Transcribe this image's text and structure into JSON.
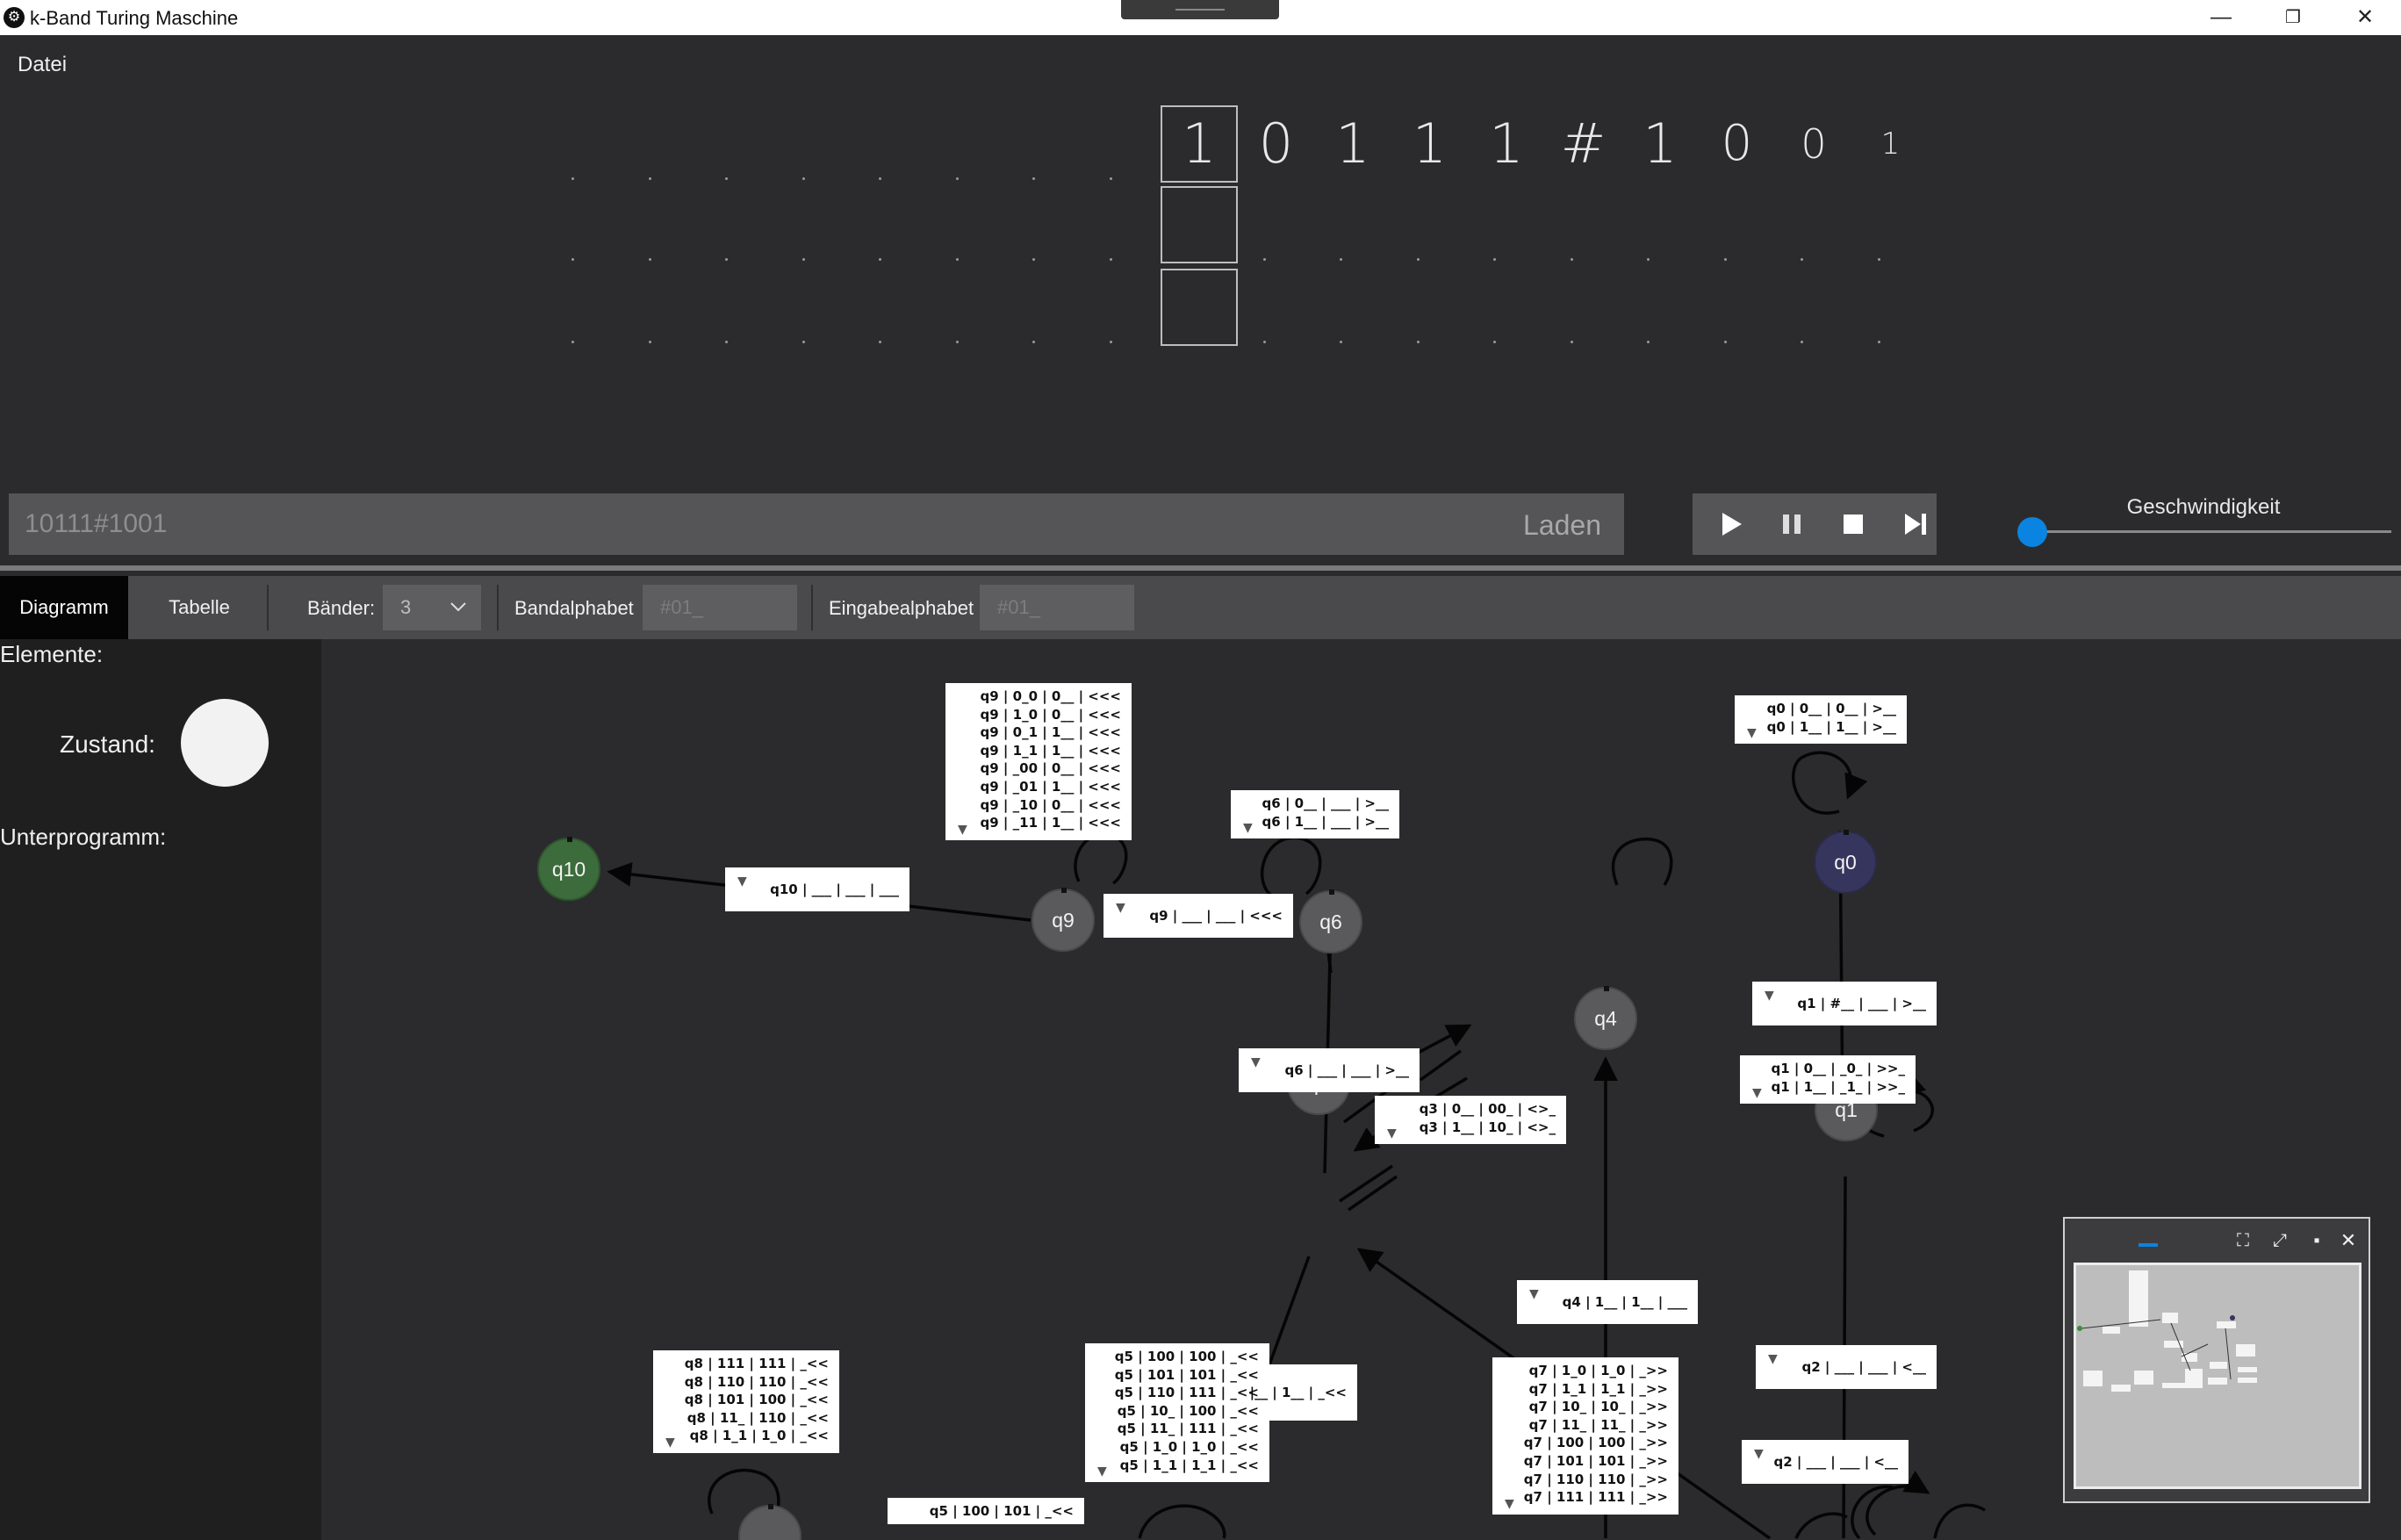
{
  "window": {
    "title": "k-Band Turing Maschine",
    "minimize": "—",
    "restore": "❐",
    "close": "✕"
  },
  "menu": {
    "file": "Datei"
  },
  "tapes": {
    "tape1": [
      "1",
      "0",
      "1",
      "1",
      "1",
      "#",
      "1",
      "0",
      "0",
      "1"
    ],
    "tape2": [],
    "tape3": []
  },
  "input": {
    "value": "10111#1001",
    "load_label": "Laden"
  },
  "speed": {
    "label": "Geschwindigkeit",
    "value": 0
  },
  "toolbar": {
    "tab_diagram": "Diagramm",
    "tab_table": "Tabelle",
    "tapes_label": "Bänder:",
    "tapes_value": "3",
    "tape_alphabet_label": "Bandalphabet",
    "tape_alphabet_value": "#01_",
    "input_alphabet_label": "Eingabealphabet",
    "input_alphabet_value": "#01_"
  },
  "sidebar": {
    "elements": "Elemente:",
    "state": "Zustand:",
    "subprogram": "Unterprogramm:"
  },
  "states": {
    "q0": "q0",
    "q1": "q1",
    "q3": "q3",
    "q4": "q4",
    "q6": "q6",
    "q9": "q9",
    "q10": "q10"
  },
  "transitions": {
    "q0_loop": [
      "q0 | 0__ | 0__ | >__",
      "q0 | 1__ | 1__ | >__"
    ],
    "q1_from_q0": [
      "q1 | #__ | ___ | >__"
    ],
    "q1_loop": [
      "q1 | 0__ | _0_ | >>_",
      "q1 | 1__ | _1_ | >>_"
    ],
    "q2_from_q1": [
      "q2 | ___ | ___ | <__"
    ],
    "q2_loop": [
      "q2 | ___ | ___ | <__"
    ],
    "q4_edge": [
      "q4 | 1__ | 1__ | ___"
    ],
    "q3_to_q4": [
      "q3 | 0__ | 00_ | <>_",
      "q3 | 1__ | 10_ | <>_"
    ],
    "q6_from_q3": [
      "q6 | ___ | ___ | >__"
    ],
    "q6_loop": [
      "q6 | 0__ | ___ | >__",
      "q6 | 1__ | ___ | >__"
    ],
    "q9_from_q6": [
      "q9 | ___ | ___ | <<<"
    ],
    "q9_loop": [
      "q9 | 0_0 | 0__ | <<<",
      "q9 | 1_0 | 0__ | <<<",
      "q9 | 0_1 | 1__ | <<<",
      "q9 | 1_1 | 1__ | <<<",
      "q9 | _00 | 0__ | <<<",
      "q9 | _01 | 1__ | <<<",
      "q9 | _10 | 0__ | <<<",
      "q9 | _11 | 1__ | <<<"
    ],
    "q10_from_q9": [
      "q10 | ___ | ___ | ___"
    ],
    "q8_loop": [
      "q8 | 111 | 111 | _<<",
      "q8 | 110 | 110 | _<<",
      "q8 | 101 | 100 | _<<",
      "q8 | 11_ | 110 | _<<",
      "q8 | 1_1 | 1_0 | _<<"
    ],
    "q5_loop": [
      "q5 | 100 | 100 | _<<",
      "q5 | 101 | 101 | _<<",
      "q5 | 110 | 111 | _<<",
      "q5 | 10_ | 100 | _<<",
      "q5 | 11_ | 111 | _<<",
      "q5 | 1_0 | 1_0 | _<<",
      "q5 | 1_1 | 1_1 | _<<"
    ],
    "q5_edge_partial": [
      "|__ | 1__ | _<<"
    ],
    "q5_bottom": [
      "q5 | 100 | 101 | _<<"
    ],
    "q7_loop": [
      "q7 | 1_0 | 1_0 | _>>",
      "q7 | 1_1 | 1_1 | _>>",
      "q7 | 10_ | 10_ | _>>",
      "q7 | 11_ | 11_ | _>>",
      "q7 | 100 | 100 | _>>",
      "q7 | 101 | 101 | _>>",
      "q7 | 110 | 110 | _>>",
      "q7 | 111 | 111 | _>>"
    ]
  },
  "colors": {
    "accent": "#0a84e0",
    "q0_fill": "#35355e",
    "q10_fill": "#3c6b3c",
    "state_fill": "#5a5a5c"
  }
}
